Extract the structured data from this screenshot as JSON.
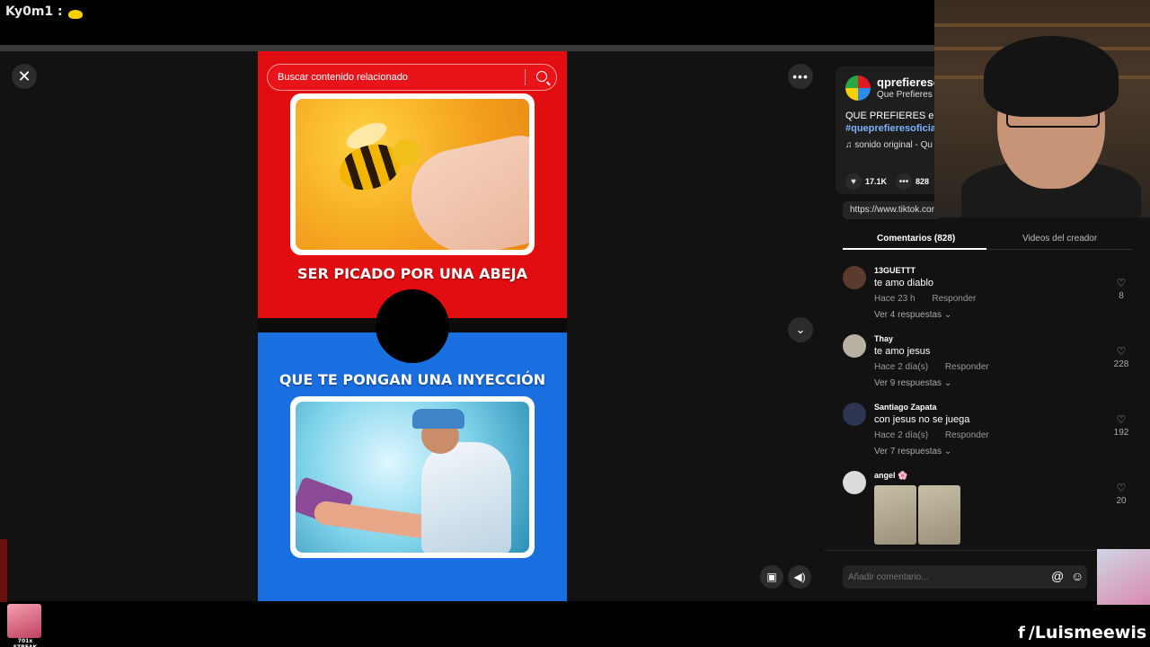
{
  "stream": {
    "chat_user": "Ky0m1 :",
    "streak_label": "701x STREAK",
    "social_handle": "/Luismeewis"
  },
  "video": {
    "search_placeholder": "Buscar contenido relacionado",
    "top_caption": "SER PICADO POR UNA ABEJA",
    "bottom_caption": "QUE TE PONGAN UNA INYECCIÓN"
  },
  "controls": {
    "close": "✕",
    "more": "•••",
    "down": "⌄",
    "pip": "▣",
    "volume": "◀)"
  },
  "creator": {
    "name": "qprefieresoficial",
    "subtitle": "Que Prefieres",
    "description": "QUE PREFIERES el q",
    "hashtag": "#queprefieresoficial",
    "music": "♫  sonido original - Qu",
    "likes": "17.1K",
    "comments": "828",
    "url": "https://www.tiktok.com"
  },
  "tabs": {
    "comments": "Comentarios (828)",
    "creator_videos": "Videos del creador"
  },
  "comments": [
    {
      "user": "13GUETTT",
      "text": "te amo diablo",
      "time": "Hace 23 h",
      "reply": "Responder",
      "replies": "Ver 4 respuestas ⌄",
      "likes": "8",
      "avatar_color": "#5a3b2e"
    },
    {
      "user": "Thay",
      "text": "te amo jesus",
      "time": "Hace 2 día(s)",
      "reply": "Responder",
      "replies": "Ver 9 respuestas ⌄",
      "likes": "228",
      "avatar_color": "#b8b0a2"
    },
    {
      "user": "Santiago Zapata",
      "text": "con jesus no se juega",
      "time": "Hace 2 día(s)",
      "reply": "Responder",
      "replies": "Ver 7 respuestas ⌄",
      "likes": "192",
      "avatar_color": "#2d3550"
    },
    {
      "user": "angel 🌸",
      "text": "",
      "likes": "20",
      "avatar_color": "#dcdcdc"
    }
  ],
  "input": {
    "placeholder": "Añadir comentario...",
    "at": "@",
    "emoji": "☺"
  }
}
